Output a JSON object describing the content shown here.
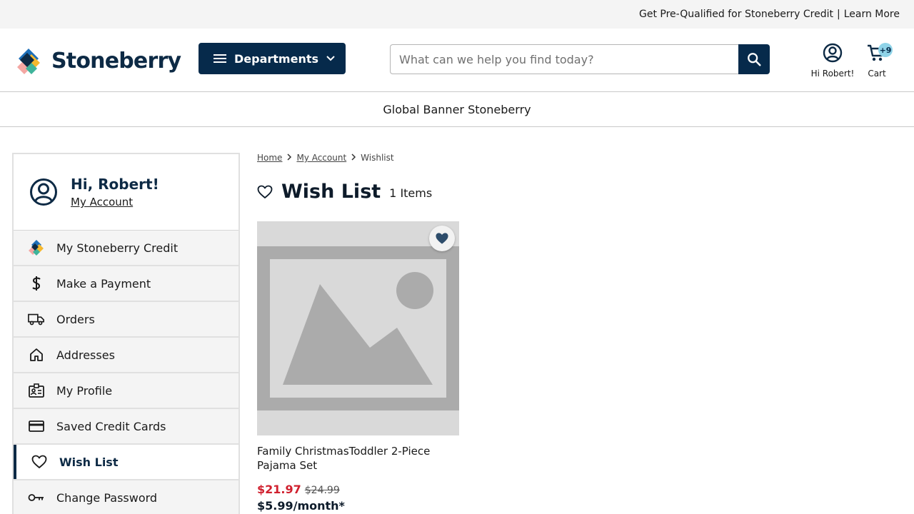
{
  "promo": {
    "prequal_text": "Get Pre-Qualified for Stoneberry Credit",
    "separator": "|",
    "learn_more": "Learn More"
  },
  "header": {
    "logo_text": "Stoneberry",
    "departments_label": "Departments",
    "search_placeholder": "What can we help you find today?",
    "search_value": "",
    "account_label": "Hi Robert!",
    "cart_label": "Cart",
    "cart_badge": "+9"
  },
  "banner": {
    "text": "Global Banner Stoneberry"
  },
  "sidebar": {
    "greeting": "Hi, Robert!",
    "my_account_link": "My Account",
    "items": [
      {
        "label": "My Stoneberry Credit",
        "icon": "stoneberry-logo-icon"
      },
      {
        "label": "Make a Payment",
        "icon": "dollar-icon"
      },
      {
        "label": "Orders",
        "icon": "truck-icon"
      },
      {
        "label": "Addresses",
        "icon": "home-icon"
      },
      {
        "label": "My Profile",
        "icon": "id-card-icon"
      },
      {
        "label": "Saved Credit Cards",
        "icon": "credit-card-icon"
      },
      {
        "label": "Wish List",
        "icon": "heart-outline-icon",
        "active": true
      },
      {
        "label": "Change Password",
        "icon": "key-icon"
      }
    ]
  },
  "breadcrumb": {
    "items": [
      "Home",
      "My Account",
      "Wishlist"
    ]
  },
  "wishlist": {
    "title": "Wish List",
    "count_text": "1 Items",
    "products": [
      {
        "name": "Family ChristmasToddler 2-Piece Pajama Set",
        "sale_price": "$21.97",
        "original_price": "$24.99",
        "monthly_price": "$5.99/month*"
      }
    ]
  },
  "colors": {
    "navy": "#062a4b",
    "sale_red": "#d0202e",
    "badge_blue": "#8fd3e8"
  }
}
